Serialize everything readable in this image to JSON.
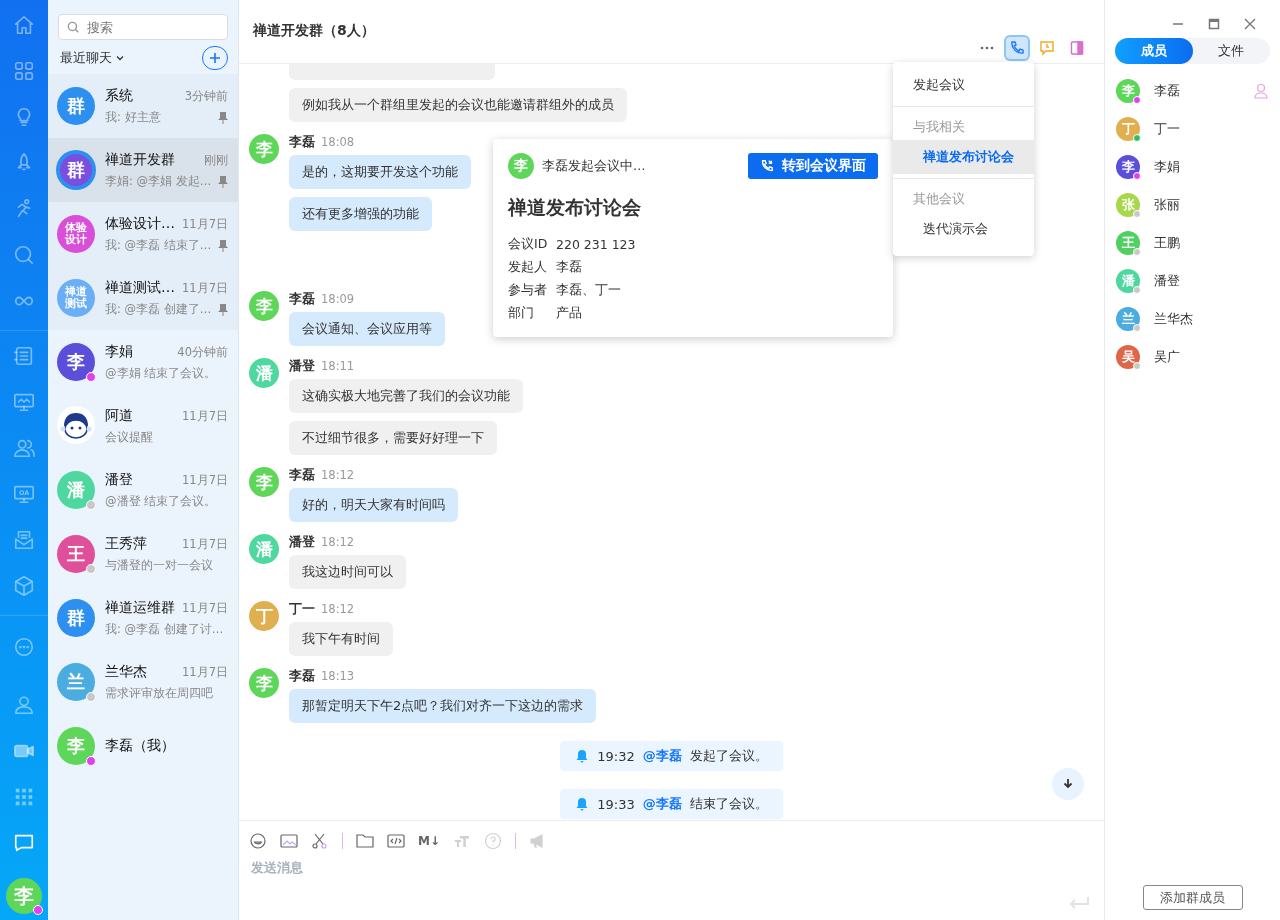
{
  "nav": {
    "top": [
      {
        "kind": "home",
        "selected": false
      },
      {
        "kind": "apps",
        "selected": false
      },
      {
        "kind": "bulb",
        "selected": false
      },
      {
        "kind": "rocket",
        "selected": false
      },
      {
        "kind": "runner",
        "selected": false
      },
      {
        "kind": "search",
        "selected": false
      },
      {
        "kind": "infinity",
        "selected": false
      }
    ],
    "middle": [
      {
        "kind": "list",
        "selected": false
      },
      {
        "kind": "monitor",
        "selected": false
      },
      {
        "kind": "contacts",
        "selected": false
      },
      {
        "kind": "oa",
        "label": "OA",
        "selected": false
      },
      {
        "kind": "inbox",
        "selected": false
      },
      {
        "kind": "cube",
        "selected": false
      }
    ],
    "bottom": [
      {
        "kind": "more",
        "selected": false
      },
      {
        "kind": "user",
        "selected": false
      },
      {
        "kind": "video",
        "selected": false
      },
      {
        "kind": "grid",
        "selected": false
      },
      {
        "kind": "chat",
        "selected": true
      }
    ],
    "user": {
      "avatar": "李",
      "color": "#5ed65a",
      "status": {
        "color": "#e040f0"
      }
    }
  },
  "chat_list": {
    "search": {
      "placeholder": "搜索"
    },
    "filter": "最近聊天",
    "items": [
      {
        "name": "系统",
        "time": "3分钟前",
        "preview": "我: 好主意",
        "avatar": {
          "kind": "char",
          "text": "群",
          "color": "#2d8ff0"
        },
        "pinned": true,
        "selected": false
      },
      {
        "name": "禅道开发群",
        "time": "刚刚",
        "preview": "李娟: @李娟 发起…",
        "avatar": {
          "kind": "char",
          "text": "群",
          "color": "#7a4fe0"
        },
        "pinned": true,
        "selected": true
      },
      {
        "name": "体验设计…",
        "time": "11月7日",
        "preview": "我: @李磊 结束了…",
        "avatar": {
          "kind": "label",
          "text": "体验设计",
          "color": "#d94fd9"
        },
        "pinned": true,
        "selected": false
      },
      {
        "name": "禅道测试…",
        "time": "11月7日",
        "preview": "我: @李磊 创建了…",
        "avatar": {
          "kind": "label",
          "text": "禅道测试",
          "color": "#6aaef5"
        },
        "pinned": true,
        "selected": false
      },
      {
        "name": "李娟",
        "time": "40分钟前",
        "preview": "@李娟 结束了会议。",
        "avatar": {
          "kind": "char",
          "text": "李",
          "color": "#5b4fd9"
        },
        "status": {
          "color": "#e040f0"
        },
        "pinned": false,
        "selected": false
      },
      {
        "name": "阿道",
        "time": "11月7日",
        "preview": "会议提醒",
        "avatar": {
          "kind": "robot"
        },
        "pinned": false,
        "selected": false
      },
      {
        "name": "潘登",
        "time": "11月7日",
        "preview": "@潘登 结束了会议。",
        "avatar": {
          "kind": "char",
          "text": "潘",
          "color": "#4ed8a0"
        },
        "status": {
          "color": "#c8c8c8"
        },
        "pinned": false,
        "selected": false
      },
      {
        "name": "王秀萍",
        "time": "11月7日",
        "preview": "与潘登的一对一会议",
        "avatar": {
          "kind": "char",
          "text": "王",
          "color": "#e0509a"
        },
        "status": {
          "color": "#c8c8c8"
        },
        "pinned": false,
        "selected": false
      },
      {
        "name": "禅道运维群",
        "time": "11月7日",
        "preview": "我: @李磊 创建了讨…",
        "avatar": {
          "kind": "char",
          "text": "群",
          "color": "#2d8ff0"
        },
        "pinned": false,
        "selected": false
      },
      {
        "name": "兰华杰",
        "time": "11月7日",
        "preview": "需求评审放在周四吧",
        "avatar": {
          "kind": "char",
          "text": "兰",
          "color": "#4aacdf"
        },
        "status": {
          "color": "#c8c8c8"
        },
        "pinned": false,
        "selected": false
      },
      {
        "name": "李磊（我）",
        "avatar": {
          "kind": "char",
          "text": "李",
          "color": "#5ed65a"
        },
        "status": {
          "color": "#e040f0"
        },
        "pinned": false,
        "selected": false
      }
    ]
  },
  "chat": {
    "title": "禅道开发群（8人）",
    "toolbar": [
      {
        "kind": "more",
        "selected": false
      },
      {
        "kind": "phone",
        "selected": true
      },
      {
        "kind": "reminder",
        "selected": false
      },
      {
        "kind": "sidebar",
        "selected": false
      }
    ],
    "groups": [
      {
        "bubbles": [
          "例如我从一个群组里发起的会议也能邀请群组外的成员"
        ],
        "mine": false
      },
      {
        "sender": "李磊",
        "time": "18:08",
        "avatar": "李",
        "color": "#5ed65a",
        "mine": true,
        "bubbles": [
          "是的，这期要开发这个功能",
          "还有更多增强的功能"
        ]
      },
      {
        "sender": "李磊",
        "time": "18:09",
        "avatar": "李",
        "color": "#5ed65a",
        "mine": true,
        "bubbles": [
          "会议通知、会议应用等"
        ]
      },
      {
        "sender": "潘登",
        "time": "18:11",
        "avatar": "潘",
        "color": "#4ed8a0",
        "mine": false,
        "bubbles": [
          "这确实极大地完善了我们的会议功能",
          "不过细节很多，需要好好理一下"
        ]
      },
      {
        "sender": "李磊",
        "time": "18:12",
        "avatar": "李",
        "color": "#5ed65a",
        "mine": true,
        "bubbles": [
          "好的，明天大家有时间吗"
        ]
      },
      {
        "sender": "潘登",
        "time": "18:12",
        "avatar": "潘",
        "color": "#4ed8a0",
        "mine": false,
        "bubbles": [
          "我这边时间可以"
        ]
      },
      {
        "sender": "丁一",
        "time": "18:12",
        "avatar": "丁",
        "color": "#e0b050",
        "mine": false,
        "bubbles": [
          "我下午有时间"
        ]
      },
      {
        "sender": "李磊",
        "time": "18:13",
        "avatar": "李",
        "color": "#5ed65a",
        "mine": true,
        "bubbles": [
          "那暂定明天下午2点吧？我们对齐一下这边的需求"
        ]
      }
    ],
    "notices": [
      {
        "time": "19:32",
        "mention": "@李磊",
        "text": "发起了会议。"
      },
      {
        "time": "19:33",
        "mention": "@李磊",
        "text": "结束了会议。"
      }
    ],
    "composer": {
      "placeholder": "发送消息",
      "tools": [
        {
          "kind": "emoji",
          "disabled": false
        },
        {
          "kind": "image",
          "disabled": false
        },
        {
          "kind": "cut",
          "disabled": false
        },
        {
          "kind": "separator"
        },
        {
          "kind": "folder",
          "disabled": false
        },
        {
          "kind": "code",
          "disabled": false
        },
        {
          "kind": "markdown",
          "label": "M↓",
          "disabled": false
        },
        {
          "kind": "font",
          "disabled": true
        },
        {
          "kind": "help",
          "disabled": true
        },
        {
          "kind": "separator"
        },
        {
          "kind": "megaphone",
          "disabled": true
        }
      ]
    }
  },
  "meeting_card": {
    "avatar": "李",
    "color": "#5ed65a",
    "status": "李磊发起会议中…",
    "button": "转到会议界面",
    "title": "禅道发布讨论会",
    "fields": [
      {
        "label": "会议ID",
        "value": "220 231 123"
      },
      {
        "label": "发起人",
        "value": "李磊"
      },
      {
        "label": "参与者",
        "value": "李磊、丁一"
      },
      {
        "label": "部门",
        "value": "产品"
      }
    ]
  },
  "meeting_menu": [
    {
      "kind": "action",
      "label": "发起会议"
    },
    {
      "kind": "header",
      "label": "与我相关"
    },
    {
      "kind": "item",
      "label": "禅道发布讨论会",
      "selected": true
    },
    {
      "kind": "header",
      "label": "其他会议"
    },
    {
      "kind": "item",
      "label": "迭代演示会",
      "selected": false
    }
  ],
  "members_panel": {
    "tabs": [
      {
        "label": "成员",
        "selected": true
      },
      {
        "label": "文件",
        "selected": false
      }
    ],
    "members": [
      {
        "name": "李磊",
        "avatar": "李",
        "color": "#5ed65a",
        "status": {
          "color": "#e040f0"
        },
        "owner": true
      },
      {
        "name": "丁一",
        "avatar": "丁",
        "color": "#e0b050",
        "status": {
          "color": "#2ec05a"
        },
        "owner": false
      },
      {
        "name": "李娟",
        "avatar": "李",
        "color": "#5b4fd9",
        "status": {
          "color": "#e040f0"
        },
        "owner": false
      },
      {
        "name": "张丽",
        "avatar": "张",
        "color": "#a8d84a",
        "status": {
          "color": "#c8c8c8"
        },
        "owner": false
      },
      {
        "name": "王鹏",
        "avatar": "王",
        "color": "#50d060",
        "status": {
          "color": "#c8c8c8"
        },
        "owner": false
      },
      {
        "name": "潘登",
        "avatar": "潘",
        "color": "#4ed8a0",
        "status": {
          "color": "#c8c8c8"
        },
        "owner": false
      },
      {
        "name": "兰华杰",
        "avatar": "兰",
        "color": "#4aacdf",
        "status": {
          "color": "#c8c8c8"
        },
        "owner": false
      },
      {
        "name": "吴广",
        "avatar": "吴",
        "color": "#e0664a",
        "status": {
          "color": "#c8c8c8"
        },
        "owner": false
      }
    ],
    "add_button": "添加群成员"
  }
}
